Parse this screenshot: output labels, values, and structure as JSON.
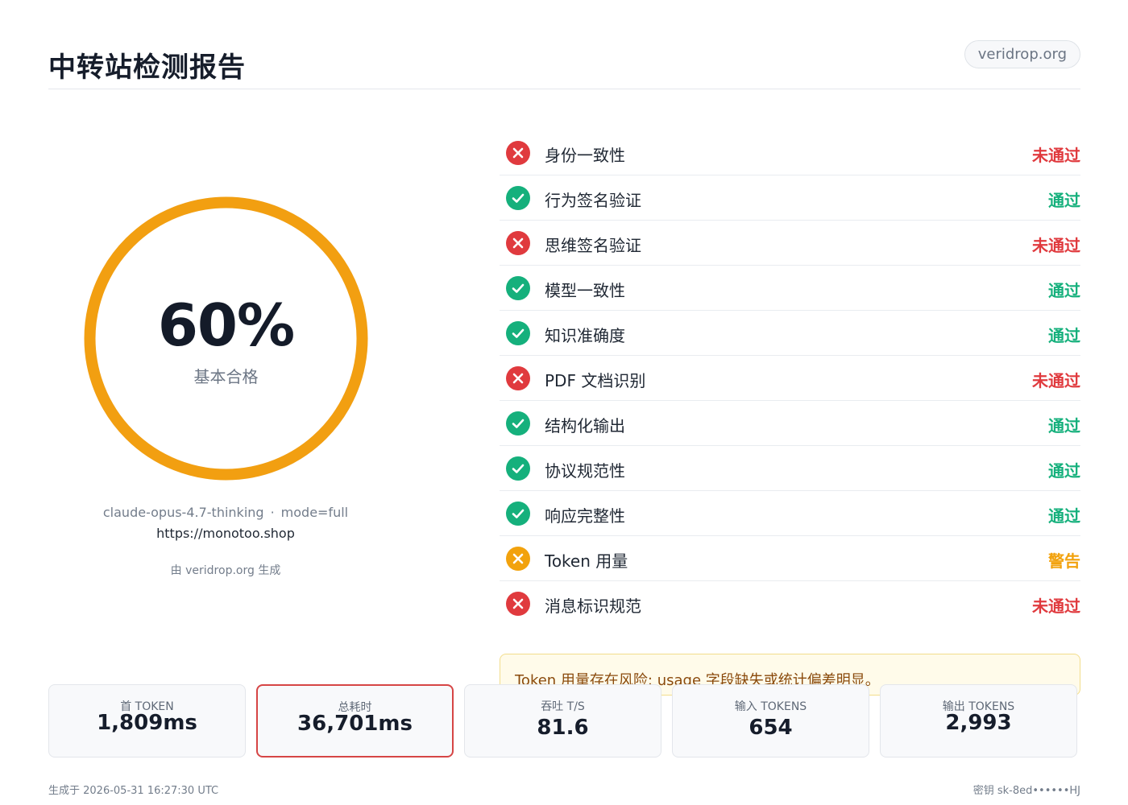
{
  "header": {
    "title": "中转站检测报告",
    "domain": "veridrop.org"
  },
  "score": {
    "percent": 0.6,
    "value_label": "60%",
    "grade": "基本合格",
    "ring_color": "#f29f11"
  },
  "meta": {
    "model": "claude-opus-4.7-thinking",
    "separator": "·",
    "mode": "mode=full",
    "url": "https://monotoo.shop",
    "generated_by": "由 veridrop.org 生成"
  },
  "colors": {
    "fail": "#e03a3e",
    "pass": "#15b07c",
    "warn": "#f2a20d"
  },
  "checks": [
    {
      "label": "身份一致性",
      "status": "未通过",
      "state": "fail",
      "icon": "cross-circle-icon"
    },
    {
      "label": "行为签名验证",
      "status": "通过",
      "state": "pass",
      "icon": "check-circle-icon"
    },
    {
      "label": "思维签名验证",
      "status": "未通过",
      "state": "fail",
      "icon": "cross-circle-icon"
    },
    {
      "label": "模型一致性",
      "status": "通过",
      "state": "pass",
      "icon": "check-circle-icon"
    },
    {
      "label": "知识准确度",
      "status": "通过",
      "state": "pass",
      "icon": "check-circle-icon"
    },
    {
      "label": "PDF 文档识别",
      "status": "未通过",
      "state": "fail",
      "icon": "cross-circle-icon"
    },
    {
      "label": "结构化输出",
      "status": "通过",
      "state": "pass",
      "icon": "check-circle-icon"
    },
    {
      "label": "协议规范性",
      "status": "通过",
      "state": "pass",
      "icon": "check-circle-icon"
    },
    {
      "label": "响应完整性",
      "status": "通过",
      "state": "pass",
      "icon": "check-circle-icon"
    },
    {
      "label": "Token 用量",
      "status": "警告",
      "state": "warn",
      "icon": "warning-cross-circle-icon"
    },
    {
      "label": "消息标识规范",
      "status": "未通过",
      "state": "fail",
      "icon": "cross-circle-icon"
    }
  ],
  "warning": {
    "text": "Token 用量存在风险: usage 字段缺失或统计偏差明显。"
  },
  "stats": [
    {
      "label": "首 TOKEN",
      "value": "1,809ms"
    },
    {
      "label": "总耗时",
      "value": "36,701ms"
    },
    {
      "label": "吞吐 T/S",
      "value": "81.6"
    },
    {
      "label": "输入 TOKENS",
      "value": "654"
    },
    {
      "label": "输出 TOKENS",
      "value": "2,993"
    }
  ],
  "footer": {
    "generated_at": "生成于 2026-05-31 16:27:30 UTC",
    "key": "密钥 sk-8ed••••••HJ"
  }
}
